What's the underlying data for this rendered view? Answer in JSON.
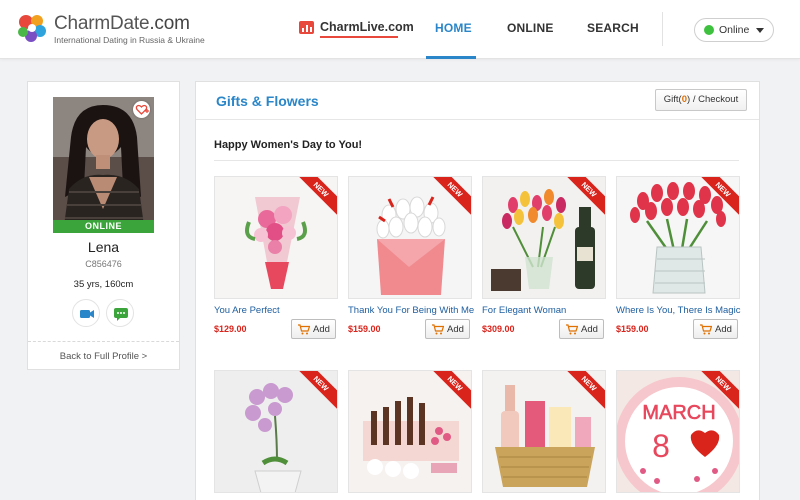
{
  "header": {
    "logo_brand": "CharmDate",
    "logo_suffix": ".com",
    "logo_tagline": "International Dating in Russia & Ukraine",
    "charmlive_label": "CharmLive.com",
    "nav": {
      "home": "HOME",
      "online": "ONLINE",
      "search": "SEARCH"
    },
    "active_nav": "HOME",
    "status": {
      "label": "Online",
      "color": "#3ec13e"
    }
  },
  "profile": {
    "name": "Lena",
    "id": "C856476",
    "age_height": "35 yrs, 160cm",
    "online_badge": "ONLINE",
    "back_link": "Back to Full Profile >"
  },
  "main": {
    "title": "Gifts & Flowers",
    "checkout": {
      "prefix": "Gift(",
      "count": "0",
      "suffix": ") / Checkout"
    },
    "section_title": "Happy Women's Day to You!",
    "badge": "NEW",
    "add_label": "Add",
    "products": [
      {
        "title": "You Are Perfect",
        "price": "$129.00"
      },
      {
        "title": "Thank You For Being With Me",
        "price": "$159.00"
      },
      {
        "title": "For Elegant Woman",
        "price": "$309.00"
      },
      {
        "title": "Where Is You, There Is Magic",
        "price": "$159.00"
      },
      {
        "title": "",
        "price": ""
      },
      {
        "title": "",
        "price": ""
      },
      {
        "title": "",
        "price": ""
      },
      {
        "title": "",
        "price": ""
      }
    ],
    "cake_text_line1": "MARCH",
    "cake_text_line2": "8"
  },
  "colors": {
    "accent": "#2a86c8",
    "price": "#d9241c",
    "online": "#3ba53b"
  }
}
